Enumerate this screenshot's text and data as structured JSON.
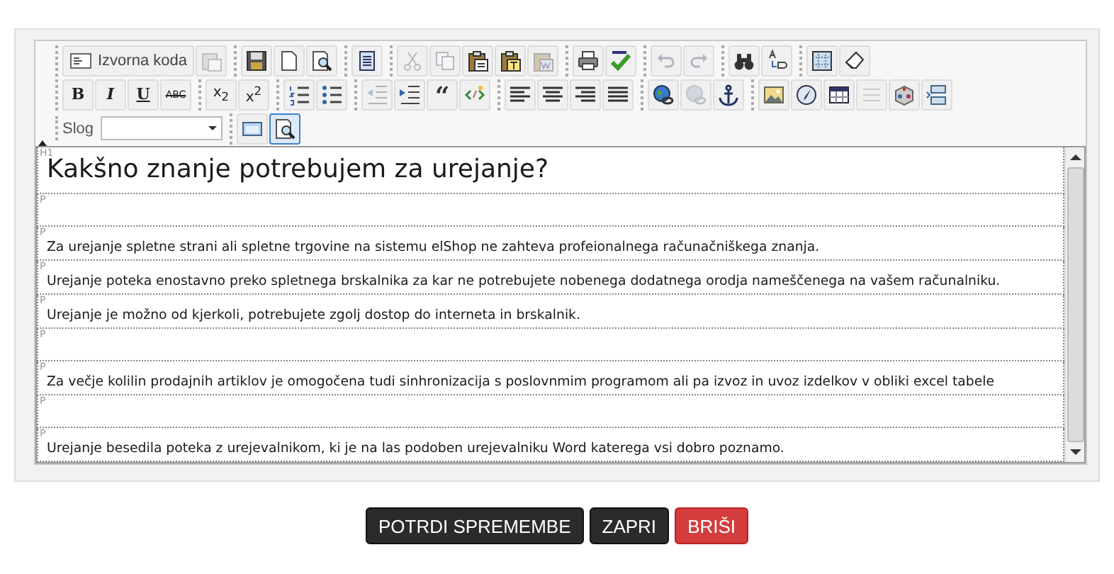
{
  "toolbar": {
    "rows": [
      {
        "groups": [
          [
            {
              "kind": "source",
              "label": "Izvorna koda",
              "disabled": false
            },
            {
              "kind": "templates",
              "disabled": true
            }
          ],
          [
            {
              "kind": "save",
              "disabled": false
            },
            {
              "kind": "new-page",
              "disabled": false
            },
            {
              "kind": "preview",
              "disabled": false
            }
          ],
          [
            {
              "kind": "document",
              "disabled": false
            }
          ],
          [
            {
              "kind": "cut",
              "disabled": true
            },
            {
              "kind": "copy",
              "disabled": true
            },
            {
              "kind": "paste",
              "disabled": false
            },
            {
              "kind": "paste-text",
              "disabled": false
            },
            {
              "kind": "paste-word",
              "disabled": true
            }
          ],
          [
            {
              "kind": "print",
              "disabled": false
            },
            {
              "kind": "spellcheck",
              "disabled": false
            }
          ],
          [
            {
              "kind": "undo",
              "disabled": true
            },
            {
              "kind": "redo",
              "disabled": true
            }
          ],
          [
            {
              "kind": "find",
              "disabled": false
            },
            {
              "kind": "replace",
              "disabled": false
            }
          ],
          [
            {
              "kind": "select-all",
              "disabled": false
            },
            {
              "kind": "eraser",
              "disabled": false
            }
          ]
        ]
      },
      {
        "groups": [
          [
            {
              "kind": "bold",
              "label": "B",
              "disabled": false
            },
            {
              "kind": "italic",
              "label": "I",
              "disabled": false
            },
            {
              "kind": "underline",
              "label": "U",
              "disabled": false
            },
            {
              "kind": "strike",
              "label": "ABC",
              "disabled": false
            }
          ],
          [
            {
              "kind": "subscript",
              "label": "x$_{2}$",
              "disabled": false
            },
            {
              "kind": "superscript",
              "label": "x$^{2}$",
              "disabled": false
            }
          ],
          [
            {
              "kind": "numbered-list",
              "disabled": false
            },
            {
              "kind": "bulleted-list",
              "disabled": false
            }
          ],
          [
            {
              "kind": "outdent",
              "disabled": true
            },
            {
              "kind": "indent",
              "disabled": false
            },
            {
              "kind": "quote",
              "label": "“",
              "disabled": false
            },
            {
              "kind": "div",
              "disabled": false
            }
          ],
          [
            {
              "kind": "align-left",
              "disabled": false
            },
            {
              "kind": "align-center",
              "disabled": false
            },
            {
              "kind": "align-right",
              "disabled": false
            },
            {
              "kind": "justify",
              "disabled": false
            }
          ],
          [
            {
              "kind": "link",
              "disabled": false
            },
            {
              "kind": "unlink",
              "disabled": true
            },
            {
              "kind": "anchor",
              "disabled": false
            }
          ],
          [
            {
              "kind": "image",
              "disabled": false
            },
            {
              "kind": "flash",
              "disabled": false
            },
            {
              "kind": "table",
              "disabled": false
            },
            {
              "kind": "rule",
              "disabled": true
            },
            {
              "kind": "cube",
              "disabled": false
            },
            {
              "kind": "page-break",
              "disabled": false
            }
          ]
        ]
      },
      {
        "style_label": "Slog",
        "groups": [
          [
            {
              "kind": "show-blocks",
              "disabled": false,
              "active": false
            },
            {
              "kind": "preview",
              "disabled": false,
              "active": true
            }
          ]
        ]
      }
    ]
  },
  "blocks": [
    {
      "kind": "heading",
      "tag": "H1",
      "text": "Kakšno znanje potrebujem za urejanje?"
    },
    {
      "kind": "paragraph",
      "tag": "P"
    },
    {
      "kind": "paragraph",
      "tag": "P",
      "text": "Za urejanje spletne strani ali spletne trgovine na sistemu elShop ne zahteva profeionalnega računačniškega znanja."
    },
    {
      "kind": "paragraph",
      "tag": "P",
      "text": "Urejanje poteka enostavno preko spletnega brskalnika za kar ne potrebujete nobenega dodatnega orodja nameščenega na vašem računalniku."
    },
    {
      "kind": "paragraph",
      "tag": "P",
      "text": "Urejanje je možno od kjerkoli, potrebujete zgolj dostop do interneta in brskalnik."
    },
    {
      "kind": "paragraph",
      "tag": "P"
    },
    {
      "kind": "paragraph",
      "tag": "P",
      "text": "Za večje kolilin prodajnih artiklov je omogočena tudi sinhronizacija s poslovnmim programom ali pa izvoz in uvoz izdelkov v obliki excel tabele"
    },
    {
      "kind": "paragraph",
      "tag": "P"
    },
    {
      "kind": "paragraph",
      "tag": "P",
      "text": "Urejanje besedila poteka z urejevalnikom, ki je na las podoben urejevalniku Word katerega vsi dobro poznamo."
    }
  ],
  "actions": [
    {
      "kind": "confirm",
      "label": "POTRDI SPREMEMBE"
    },
    {
      "kind": "close",
      "label": "ZAPRI"
    },
    {
      "kind": "delete",
      "label": "BRIŠI"
    }
  ]
}
